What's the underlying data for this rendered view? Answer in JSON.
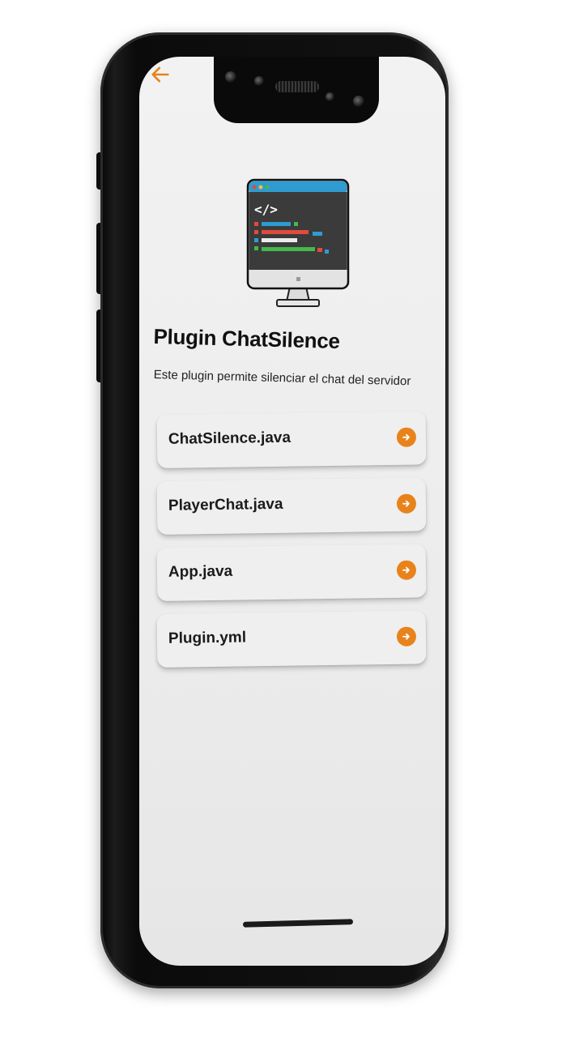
{
  "app": {
    "title": "Plugin ChatSilence",
    "description": "Este plugin permite silenciar el chat del servidor",
    "accent_color": "#e8831c"
  },
  "nav": {
    "back_icon": "arrow-left-icon"
  },
  "files": [
    {
      "label": "ChatSilence.java",
      "icon": "arrow-right-circle-icon"
    },
    {
      "label": "PlayerChat.java",
      "icon": "arrow-right-circle-icon"
    },
    {
      "label": "App.java",
      "icon": "arrow-right-circle-icon"
    },
    {
      "label": "Plugin.yml",
      "icon": "arrow-right-circle-icon"
    }
  ],
  "illustration": {
    "icon": "code-monitor-icon",
    "code_symbol": "</>"
  }
}
